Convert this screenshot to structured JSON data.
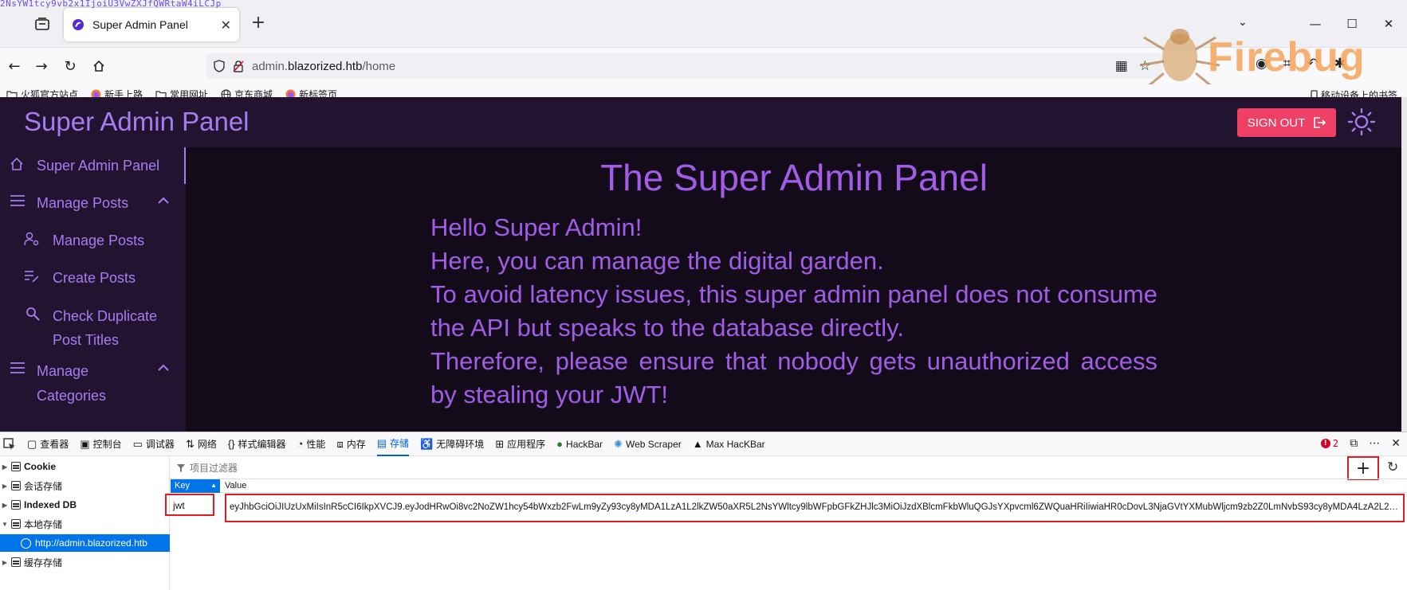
{
  "browser": {
    "stray_text": "2NsYW1tcy9vb2x1IjoiU3VwZXJfQWRtaW4iLCJp",
    "tab_title": "Super Admin Panel",
    "url_prefix": "admin.",
    "url_host": "blazorized.htb",
    "url_path": "/home",
    "firebug_logo": "Firebug",
    "bookmarks": [
      {
        "label": "火狐官方站点",
        "icon": "folder-icon"
      },
      {
        "label": "新手上路",
        "icon": "firefox-icon"
      },
      {
        "label": "常用网址",
        "icon": "folder-icon"
      },
      {
        "label": "京东商城",
        "icon": "globe-icon"
      },
      {
        "label": "新标签页",
        "icon": "firefox-icon"
      }
    ],
    "mobile_bookmarks": "移动设备上的书签"
  },
  "app": {
    "title": "Super Admin Panel",
    "signout_label": "SIGN OUT",
    "sidebar": [
      {
        "label": "Super Admin Panel",
        "icon": "home-icon"
      },
      {
        "label": "Manage Posts",
        "icon": "menu-icon"
      },
      {
        "label": "Manage Posts",
        "icon": "user-settings-icon"
      },
      {
        "label": "Create Posts",
        "icon": "edit-list-icon"
      },
      {
        "label": "Check Duplicate",
        "label2": "Post Titles",
        "icon": "search-icon"
      },
      {
        "label": "Manage",
        "label2": "Categories",
        "icon": "menu-icon"
      }
    ],
    "heading": "The Super Admin Panel",
    "paragraphs": [
      "Hello Super Admin!",
      "Here, you can manage the digital garden.",
      "To avoid latency issues, this super admin panel does not consume the API but speaks to the database directly.",
      "Therefore, please ensure that nobody gets unauthorized access by stealing your JWT!"
    ]
  },
  "devtools": {
    "tabs": [
      {
        "label": "查看器",
        "icon": "inspector-icon"
      },
      {
        "label": "控制台",
        "icon": "console-icon"
      },
      {
        "label": "调试器",
        "icon": "debugger-icon"
      },
      {
        "label": "网络",
        "icon": "network-icon"
      },
      {
        "label": "样式编辑器",
        "icon": "braces-icon"
      },
      {
        "label": "性能",
        "icon": "gauge-icon"
      },
      {
        "label": "内存",
        "icon": "memory-icon"
      },
      {
        "label": "存储",
        "icon": "storage-icon",
        "active": true
      },
      {
        "label": "无障碍环境",
        "icon": "accessibility-icon"
      },
      {
        "label": "应用程序",
        "icon": "grid-icon"
      },
      {
        "label": "HackBar",
        "icon": "hackbar-icon"
      },
      {
        "label": "Web Scraper",
        "icon": "spider-icon"
      },
      {
        "label": "Max HacKBar",
        "icon": "hat-icon"
      }
    ],
    "error_count": "2",
    "tree": [
      {
        "label": "Cookie",
        "bold": true
      },
      {
        "label": "会话存储"
      },
      {
        "label": "Indexed DB",
        "bold": true
      },
      {
        "label": "本地存储",
        "expanded": true
      },
      {
        "label": "http://admin.blazorized.htb",
        "selected": true
      },
      {
        "label": "缓存存储"
      }
    ],
    "filter_placeholder": "项目过滤器",
    "columns": {
      "key": "Key",
      "value": "Value"
    },
    "row": {
      "key": "jwt",
      "value": "eyJhbGciOiJIUzUxMiIsInR5cCI6IkpXVCJ9.eyJodHRwOi8vc2NoZW1hcy54bWxzb2FwLm9yZy93cy8yMDA1LzA1L2lkZW50aXR5L2NsYWltcy9lbWFpbGFkZHJlc3MiOiJzdXBlcmFkbWluQGJsYXpvcml6ZWQuaHRiIiwiaHR0cDovL3NjaGVtYXMubWljcm9zb2Z0LmNvbS93cy8yMDA4LzA2L2lkZ..."
    }
  },
  "colors": {
    "accent": "#a15de8",
    "header_bg": "#221330",
    "content_bg": "#130b19",
    "signout_bg": "#ee3f64",
    "highlight_border": "#e01b24",
    "devtools_active": "#0074e8"
  }
}
